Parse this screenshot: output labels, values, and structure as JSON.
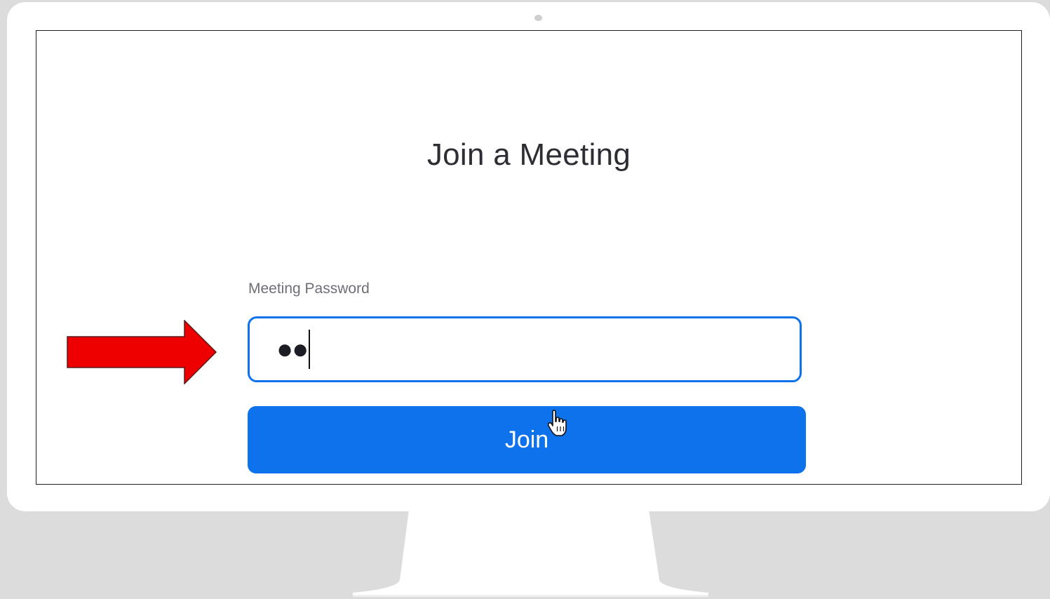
{
  "page": {
    "title": "Join a Meeting"
  },
  "password": {
    "label": "Meeting Password",
    "value_masked": "●●"
  },
  "join_button": {
    "label": "Join"
  },
  "icons": {
    "cursor": "hand-pointer-icon",
    "annotation": "red-arrow-icon",
    "camera": "camera-icon"
  },
  "colors": {
    "accent": "#0e72ed",
    "annotation": "#ee0000",
    "title_text": "#2d2d33",
    "label_text": "#6e6e78"
  }
}
